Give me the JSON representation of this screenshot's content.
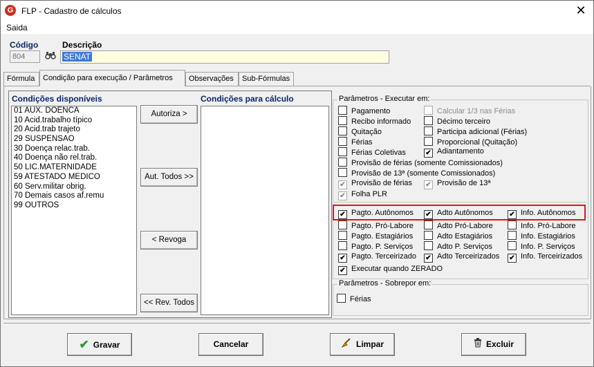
{
  "window": {
    "title": "FLP - Cadastro de cálculos",
    "app_icon": "G",
    "close": "✕"
  },
  "menu": {
    "items": [
      "Saida"
    ]
  },
  "header": {
    "codigo_label": "Código",
    "codigo_value": "804",
    "descricao_label": "Descrição",
    "descricao_value": "SENAT"
  },
  "tabs": [
    "Fórmula",
    "Condição para execução / Parâmetros",
    "Observações",
    "Sub-Fórmulas"
  ],
  "conditions": {
    "available_label": "Condições disponíveis",
    "available": [
      "01 AUX. DOENCA",
      "10 Acid.trabalho típico",
      "20 Acid.trab trajeto",
      "29 SUSPENSAO",
      "30 Doença relac.trab.",
      "40 Doença não rel.trab.",
      "50 LIC.MATERNIDADE",
      "59 ATESTADO MEDICO",
      "60 Serv.militar obrig.",
      "70 Demais casos af.remu",
      "99 OUTROS"
    ],
    "for_calc_label": "Condições para cálculo",
    "buttons": {
      "autoriza": "Autoriza >",
      "aut_todos": "Aut. Todos >>",
      "revoga": "< Revoga",
      "rev_todos": "<< Rev. Todos"
    }
  },
  "params": {
    "exec_legend": "Parâmetros - Executar em:",
    "col1": [
      {
        "label": "Pagamento",
        "checked": false
      },
      {
        "label": "Recibo informado",
        "checked": false
      },
      {
        "label": "Quitação",
        "checked": false
      },
      {
        "label": "Férias",
        "checked": false
      },
      {
        "label": "Férias Coletivas",
        "checked": false
      }
    ],
    "col2": [
      {
        "label": "Calcular 1/3 nas Férias",
        "checked": false,
        "disabled": true
      },
      {
        "label": "Décimo terceiro",
        "checked": false
      },
      {
        "label": "Participa adicional (Férias)",
        "checked": false
      },
      {
        "label": "Proporcional (Quitação)",
        "checked": false
      },
      {
        "label": "Adiantamento",
        "checked": true
      }
    ],
    "prov_ferias_comis": "Provisão de férias (somente Comissionados)",
    "prov_13_comis": "Provisão de 13ª (somente Comissionados)",
    "prov_ferias": "Provisão de férias",
    "prov_13": "Provisão de 13ª",
    "folha_plr": "Folha PLR",
    "grid": [
      [
        {
          "label": "Pagto. Autônomos",
          "checked": true
        },
        {
          "label": "Adto Autônomos",
          "checked": true
        },
        {
          "label": "Info. Autônomos",
          "checked": true
        }
      ],
      [
        {
          "label": "Pagto. Pró-Labore",
          "checked": false
        },
        {
          "label": "Adto Pró-Labore",
          "checked": false
        },
        {
          "label": "Info. Pró-Labore",
          "checked": false
        }
      ],
      [
        {
          "label": "Pagto. Estagiários",
          "checked": false
        },
        {
          "label": "Adto Estagiários",
          "checked": false
        },
        {
          "label": "Info. Estagiários",
          "checked": false
        }
      ],
      [
        {
          "label": "Pagto. P. Serviços",
          "checked": false
        },
        {
          "label": "Adto P. Serviços",
          "checked": false
        },
        {
          "label": "Info. P. Serviços",
          "checked": false
        }
      ],
      [
        {
          "label": "Pagto. Terceirizado",
          "checked": true
        },
        {
          "label": "Adto Terceirizados",
          "checked": true
        },
        {
          "label": "Info. Terceirizados",
          "checked": true
        }
      ]
    ],
    "exec_zerado": "Executar quando ZERADO",
    "sobrepor_legend": "Parâmetros - Sobrepor em:",
    "sobrepor_ferias": "Férias"
  },
  "actions": {
    "gravar": "Gravar",
    "cancelar": "Cancelar",
    "limpar": "Limpar",
    "excluir": "Excluir"
  },
  "colors": {
    "highlight": "#e0141e",
    "desc_bg": "#ffffe1",
    "selection": "#3a7bd5"
  }
}
